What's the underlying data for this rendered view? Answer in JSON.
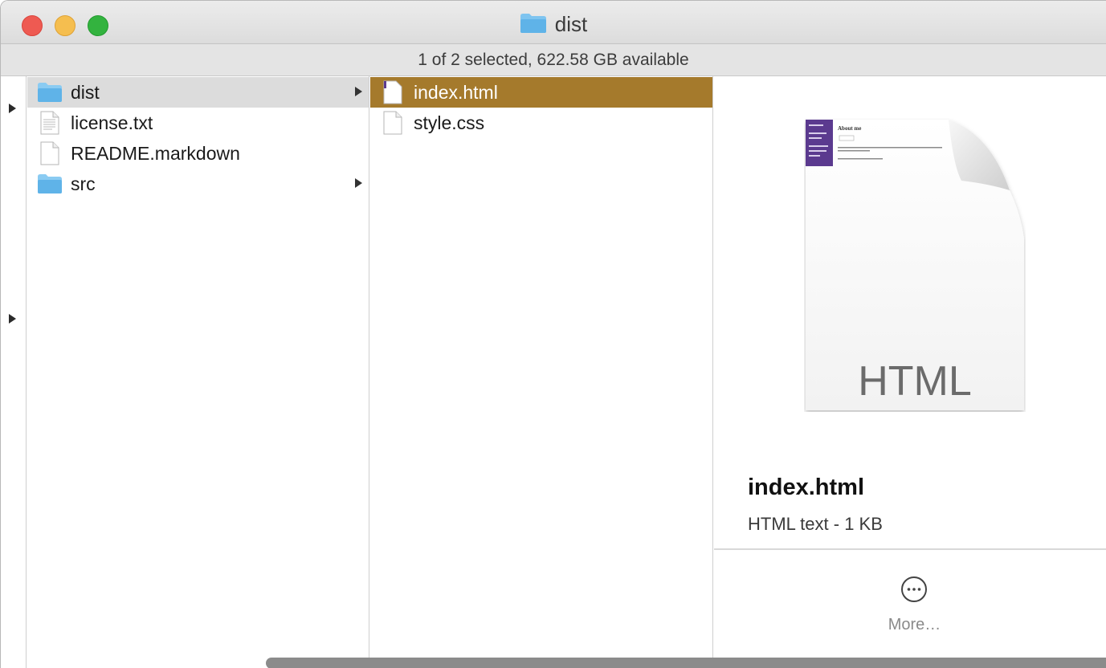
{
  "window": {
    "title": "dist",
    "status": "1 of 2 selected, 622.58 GB available"
  },
  "column1": {
    "items": [
      {
        "label": "dist",
        "icon": "folder-icon",
        "has_children": true,
        "state": "inactive-selected"
      },
      {
        "label": "license.txt",
        "icon": "text-document-icon",
        "has_children": false,
        "state": "normal"
      },
      {
        "label": "README.markdown",
        "icon": "document-icon",
        "has_children": false,
        "state": "normal"
      },
      {
        "label": "src",
        "icon": "folder-icon",
        "has_children": true,
        "state": "normal"
      }
    ]
  },
  "column2": {
    "items": [
      {
        "label": "index.html",
        "icon": "html-document-icon",
        "state": "selected"
      },
      {
        "label": "style.css",
        "icon": "document-icon",
        "state": "normal"
      }
    ]
  },
  "preview": {
    "file_name": "index.html",
    "file_kind": "HTML text - 1 KB",
    "badge": "HTML",
    "thumb_heading": "About me",
    "more_label": "More…"
  },
  "colors": {
    "selection": "#a57a2c",
    "inactive_selection": "#dcdcdc",
    "folder": "#5fb3e8",
    "thumb_sidebar": "#5b3a8f"
  }
}
